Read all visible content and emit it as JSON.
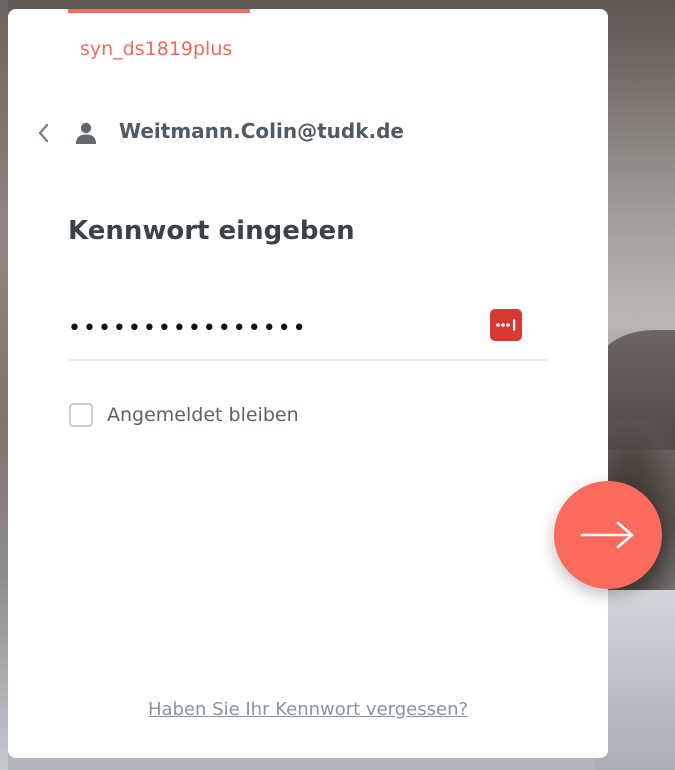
{
  "server": {
    "name": "syn_ds1819plus"
  },
  "user": {
    "email": "Weitmann.Colin@tudk.de"
  },
  "form": {
    "heading": "Kennwort eingeben",
    "password_value": "••••••••••••••••",
    "remember_label": "Angemeldet bleiben",
    "remember_checked": false,
    "forgot_link": "Haben Sie Ihr Kennwort vergessen?"
  },
  "icons": {
    "back": "chevron-left-icon",
    "user": "user-icon",
    "password_manager": "password-manager-icon",
    "next": "arrow-right-icon"
  },
  "colors": {
    "accent": "#fa6b5e",
    "password_manager": "#d43a32",
    "heading": "#3a4148"
  }
}
